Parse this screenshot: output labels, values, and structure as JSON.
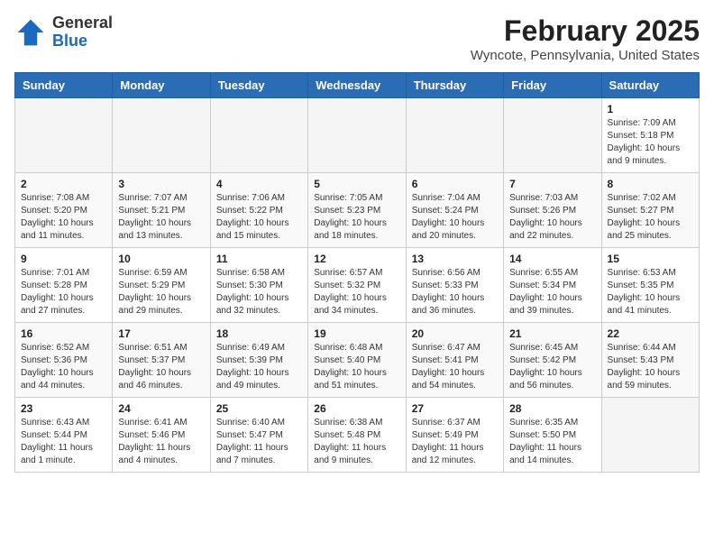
{
  "header": {
    "logo_line1": "General",
    "logo_line2": "Blue",
    "month_year": "February 2025",
    "location": "Wyncote, Pennsylvania, United States"
  },
  "weekdays": [
    "Sunday",
    "Monday",
    "Tuesday",
    "Wednesday",
    "Thursday",
    "Friday",
    "Saturday"
  ],
  "weeks": [
    [
      {
        "day": "",
        "info": ""
      },
      {
        "day": "",
        "info": ""
      },
      {
        "day": "",
        "info": ""
      },
      {
        "day": "",
        "info": ""
      },
      {
        "day": "",
        "info": ""
      },
      {
        "day": "",
        "info": ""
      },
      {
        "day": "1",
        "info": "Sunrise: 7:09 AM\nSunset: 5:18 PM\nDaylight: 10 hours\nand 9 minutes."
      }
    ],
    [
      {
        "day": "2",
        "info": "Sunrise: 7:08 AM\nSunset: 5:20 PM\nDaylight: 10 hours\nand 11 minutes."
      },
      {
        "day": "3",
        "info": "Sunrise: 7:07 AM\nSunset: 5:21 PM\nDaylight: 10 hours\nand 13 minutes."
      },
      {
        "day": "4",
        "info": "Sunrise: 7:06 AM\nSunset: 5:22 PM\nDaylight: 10 hours\nand 15 minutes."
      },
      {
        "day": "5",
        "info": "Sunrise: 7:05 AM\nSunset: 5:23 PM\nDaylight: 10 hours\nand 18 minutes."
      },
      {
        "day": "6",
        "info": "Sunrise: 7:04 AM\nSunset: 5:24 PM\nDaylight: 10 hours\nand 20 minutes."
      },
      {
        "day": "7",
        "info": "Sunrise: 7:03 AM\nSunset: 5:26 PM\nDaylight: 10 hours\nand 22 minutes."
      },
      {
        "day": "8",
        "info": "Sunrise: 7:02 AM\nSunset: 5:27 PM\nDaylight: 10 hours\nand 25 minutes."
      }
    ],
    [
      {
        "day": "9",
        "info": "Sunrise: 7:01 AM\nSunset: 5:28 PM\nDaylight: 10 hours\nand 27 minutes."
      },
      {
        "day": "10",
        "info": "Sunrise: 6:59 AM\nSunset: 5:29 PM\nDaylight: 10 hours\nand 29 minutes."
      },
      {
        "day": "11",
        "info": "Sunrise: 6:58 AM\nSunset: 5:30 PM\nDaylight: 10 hours\nand 32 minutes."
      },
      {
        "day": "12",
        "info": "Sunrise: 6:57 AM\nSunset: 5:32 PM\nDaylight: 10 hours\nand 34 minutes."
      },
      {
        "day": "13",
        "info": "Sunrise: 6:56 AM\nSunset: 5:33 PM\nDaylight: 10 hours\nand 36 minutes."
      },
      {
        "day": "14",
        "info": "Sunrise: 6:55 AM\nSunset: 5:34 PM\nDaylight: 10 hours\nand 39 minutes."
      },
      {
        "day": "15",
        "info": "Sunrise: 6:53 AM\nSunset: 5:35 PM\nDaylight: 10 hours\nand 41 minutes."
      }
    ],
    [
      {
        "day": "16",
        "info": "Sunrise: 6:52 AM\nSunset: 5:36 PM\nDaylight: 10 hours\nand 44 minutes."
      },
      {
        "day": "17",
        "info": "Sunrise: 6:51 AM\nSunset: 5:37 PM\nDaylight: 10 hours\nand 46 minutes."
      },
      {
        "day": "18",
        "info": "Sunrise: 6:49 AM\nSunset: 5:39 PM\nDaylight: 10 hours\nand 49 minutes."
      },
      {
        "day": "19",
        "info": "Sunrise: 6:48 AM\nSunset: 5:40 PM\nDaylight: 10 hours\nand 51 minutes."
      },
      {
        "day": "20",
        "info": "Sunrise: 6:47 AM\nSunset: 5:41 PM\nDaylight: 10 hours\nand 54 minutes."
      },
      {
        "day": "21",
        "info": "Sunrise: 6:45 AM\nSunset: 5:42 PM\nDaylight: 10 hours\nand 56 minutes."
      },
      {
        "day": "22",
        "info": "Sunrise: 6:44 AM\nSunset: 5:43 PM\nDaylight: 10 hours\nand 59 minutes."
      }
    ],
    [
      {
        "day": "23",
        "info": "Sunrise: 6:43 AM\nSunset: 5:44 PM\nDaylight: 11 hours\nand 1 minute."
      },
      {
        "day": "24",
        "info": "Sunrise: 6:41 AM\nSunset: 5:46 PM\nDaylight: 11 hours\nand 4 minutes."
      },
      {
        "day": "25",
        "info": "Sunrise: 6:40 AM\nSunset: 5:47 PM\nDaylight: 11 hours\nand 7 minutes."
      },
      {
        "day": "26",
        "info": "Sunrise: 6:38 AM\nSunset: 5:48 PM\nDaylight: 11 hours\nand 9 minutes."
      },
      {
        "day": "27",
        "info": "Sunrise: 6:37 AM\nSunset: 5:49 PM\nDaylight: 11 hours\nand 12 minutes."
      },
      {
        "day": "28",
        "info": "Sunrise: 6:35 AM\nSunset: 5:50 PM\nDaylight: 11 hours\nand 14 minutes."
      },
      {
        "day": "",
        "info": ""
      }
    ]
  ]
}
